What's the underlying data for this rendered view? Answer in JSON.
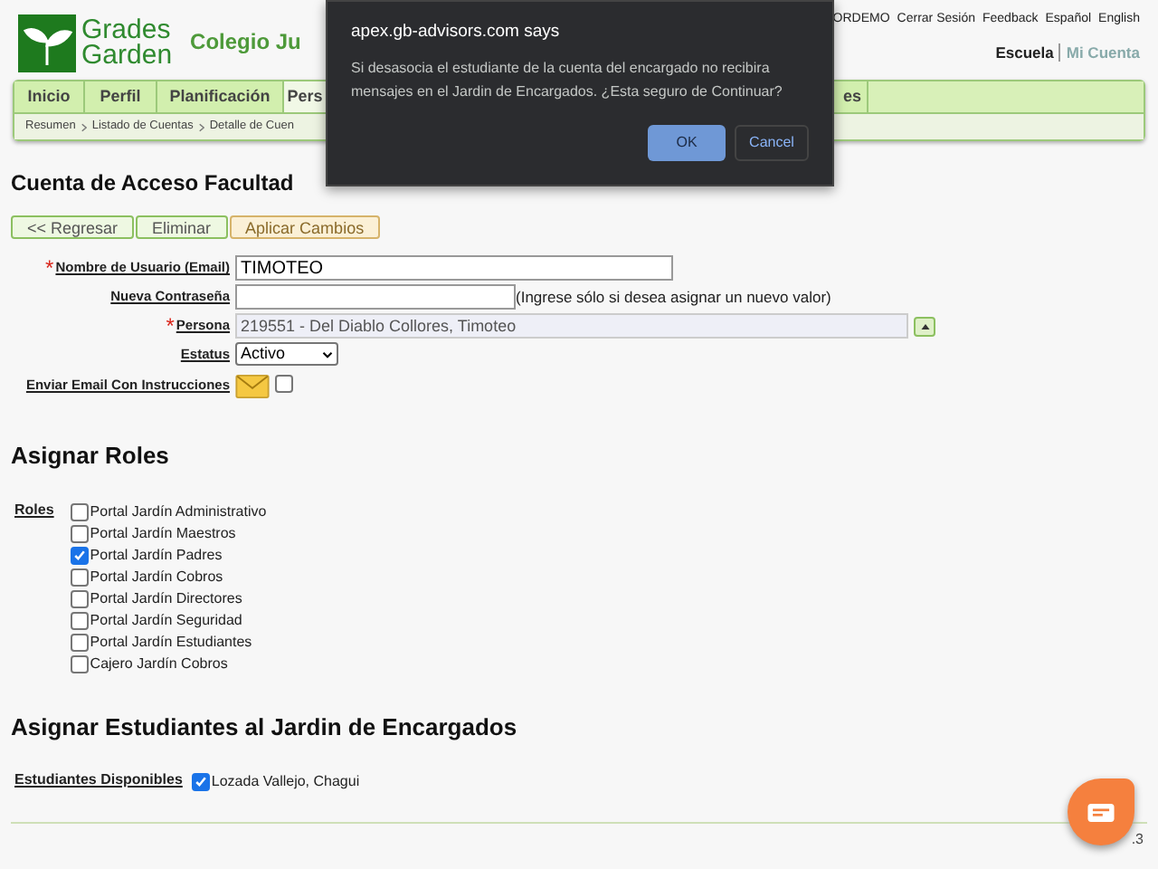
{
  "header": {
    "logo": {
      "line1": "Grades",
      "line2": "Garden"
    },
    "school": "Colegio Ju",
    "top_links": [
      "ORDEMO",
      "Cerrar Sesión",
      "Feedback",
      "Español",
      "English"
    ],
    "account_links": [
      {
        "label": "Escuela",
        "selected": true
      },
      {
        "label": "Mi Cuenta",
        "selected": false
      }
    ]
  },
  "tabs": [
    {
      "label": "Inicio",
      "selected": false
    },
    {
      "label": "Perfil",
      "selected": false
    },
    {
      "label": "Planificación",
      "selected": false
    },
    {
      "label": "Pers",
      "selected": true
    },
    {
      "label": "es",
      "selected": false
    }
  ],
  "breadcrumb": [
    "Resumen",
    "Listado de Cuentas",
    "Detalle de Cuen"
  ],
  "page_title": "Cuenta de Acceso Facultad",
  "buttons": [
    {
      "label": "<< Regresar",
      "kind": "normal"
    },
    {
      "label": "Eliminar",
      "kind": "normal"
    },
    {
      "label": "Aplicar Cambios",
      "kind": "primary"
    }
  ],
  "form": [
    {
      "kind": "text",
      "label": "Nombre de Usuario (Email)",
      "required_mark": "*",
      "value": "TIMOTEO"
    },
    {
      "kind": "password",
      "label": "Nueva Contraseña",
      "hint": "(Ingrese sólo si desea asignar un nuevo valor)"
    },
    {
      "kind": "lookup",
      "label": "Persona",
      "required_mark": "*",
      "value": "219551 - Del Diablo Collores, Timoteo"
    },
    {
      "kind": "select",
      "label": "Estatus",
      "value": "Activo"
    },
    {
      "kind": "email",
      "label": "Enviar Email Con Instrucciones",
      "checked": false
    }
  ],
  "roles_section": {
    "title": "Asignar Roles",
    "label": "Roles",
    "roles": [
      {
        "label": "Portal Jardín Administrativo",
        "checked": false
      },
      {
        "label": "Portal Jardín Maestros",
        "checked": false
      },
      {
        "label": "Portal Jardín Padres",
        "checked": true
      },
      {
        "label": "Portal Jardín Cobros",
        "checked": false
      },
      {
        "label": "Portal Jardín Directores",
        "checked": false
      },
      {
        "label": "Portal Jardín Seguridad",
        "checked": false
      },
      {
        "label": "Portal Jardín Estudiantes",
        "checked": false
      },
      {
        "label": "Cajero Jardín Cobros",
        "checked": false
      }
    ]
  },
  "students_section": {
    "title": "Asignar Estudiantes al Jardin de Encargados",
    "label": "Estudiantes Disponibles",
    "students": [
      {
        "label": "Lozada Vallejo, Chagui",
        "checked": true
      }
    ]
  },
  "footer": ".3",
  "dialog": {
    "title": "apex.gb-advisors.com says",
    "message": "Si desasocia el estudiante de la cuenta del encargado no recibira mensajes en el Jardin de Encargados. ¿Esta seguro de Continuar?",
    "buttons": [
      {
        "label": "OK",
        "kind": "primary"
      },
      {
        "label": "Cancel",
        "kind": "secondary"
      }
    ]
  }
}
